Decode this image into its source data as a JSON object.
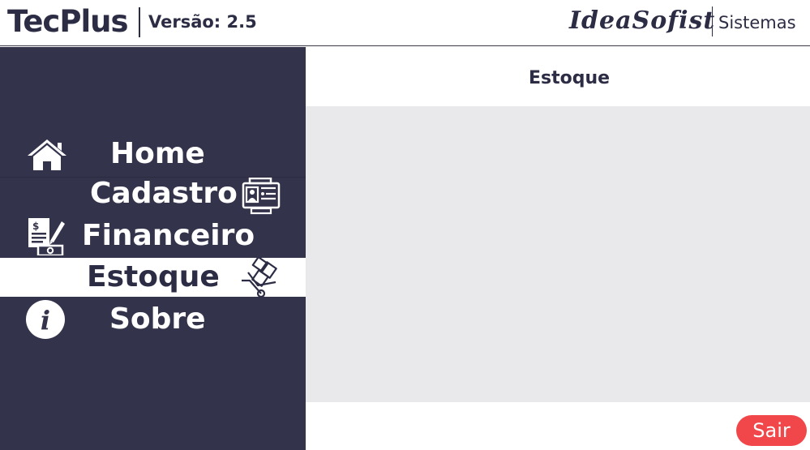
{
  "header": {
    "app_name": "TecPlus",
    "version": "Versão: 2.5",
    "company": "IdeaSofist",
    "company_sub": "Sistemas"
  },
  "sidebar": {
    "items": [
      {
        "label": "Home",
        "icon": "home-icon",
        "active": false
      },
      {
        "label": "Cadastro",
        "icon": "id-card-icon",
        "active": false
      },
      {
        "label": "Financeiro",
        "icon": "invoice-icon",
        "active": false
      },
      {
        "label": "Estoque",
        "icon": "hand-truck-icon",
        "active": true
      },
      {
        "label": "Sobre",
        "icon": "info-icon",
        "active": false
      }
    ]
  },
  "main": {
    "title": "Estoque",
    "exit_label": "Sair"
  },
  "colors": {
    "sidebar_bg": "#34334c",
    "text_dark": "#2c2d45",
    "content_bg": "#e9e9ec",
    "exit_button": "#f2474a"
  }
}
